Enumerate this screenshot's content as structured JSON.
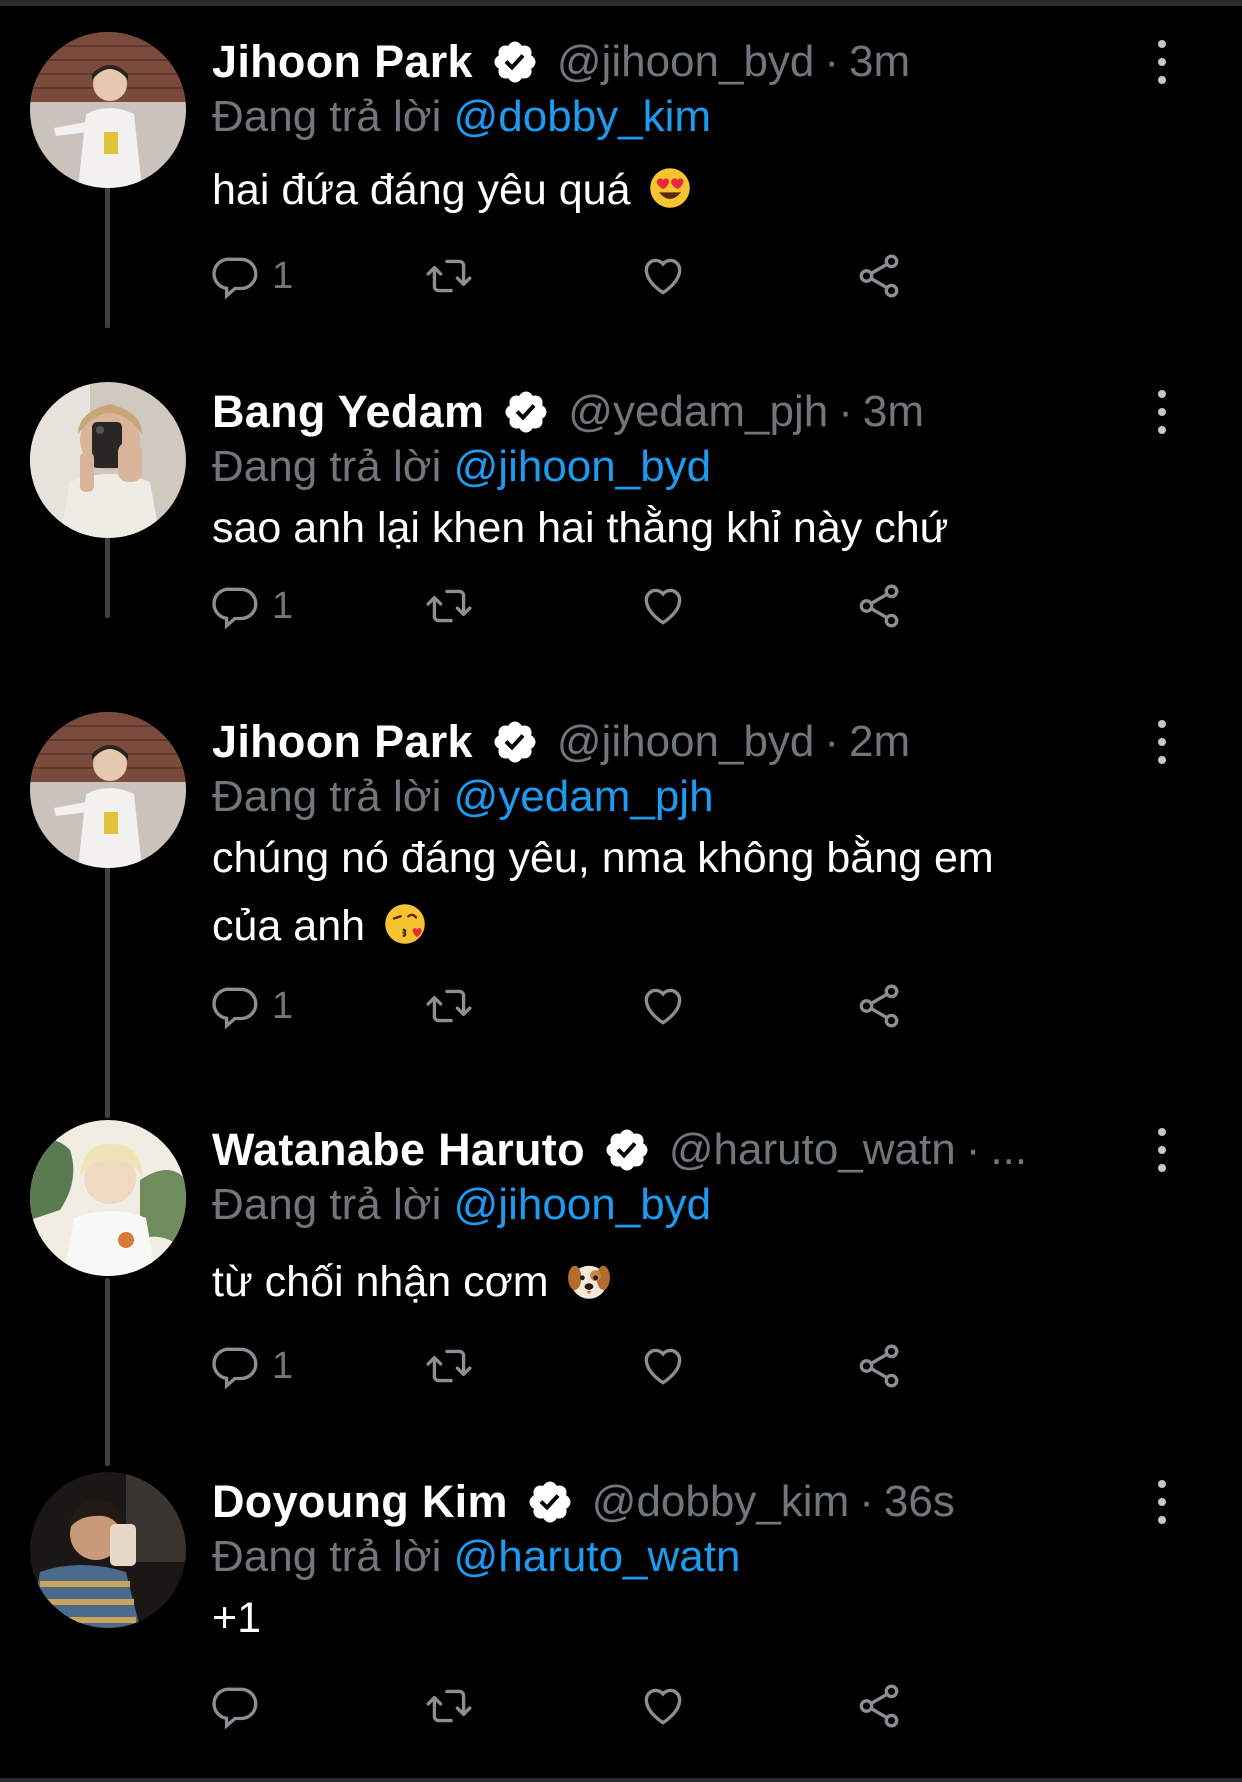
{
  "colors": {
    "background": "#000000",
    "mention": "#1d9bf0",
    "secondary_text": "#71767b",
    "verified_badge": "#ffffff"
  },
  "tweets": [
    {
      "name": "Jihoon Park",
      "handle": "@jihoon_byd",
      "separator": "·",
      "time": "3m",
      "reply_prefix": "Đang trả lời",
      "reply_to": "@dobby_kim",
      "text": "hai đứa đáng yêu quá",
      "emoji": "smiling-face-heart-eyes",
      "reply_count": "1",
      "avatar": "jihoon-avatar"
    },
    {
      "name": "Bang Yedam",
      "handle": "@yedam_pjh",
      "separator": "·",
      "time": "3m",
      "reply_prefix": "Đang trả lời",
      "reply_to": "@jihoon_byd",
      "text": "sao anh lại khen hai thằng khỉ này chứ",
      "emoji": "",
      "reply_count": "1",
      "avatar": "yedam-avatar"
    },
    {
      "name": "Jihoon Park",
      "handle": "@jihoon_byd",
      "separator": "·",
      "time": "2m",
      "reply_prefix": "Đang trả lời",
      "reply_to": "@yedam_pjh",
      "text_line1": "chúng nó đáng yêu, nma không bằng em",
      "text_line2": "của anh",
      "emoji": "face-blowing-kiss",
      "reply_count": "1",
      "avatar": "jihoon-avatar"
    },
    {
      "name": "Watanabe Haruto",
      "handle": "@haruto_watn",
      "separator": "·",
      "time": "...",
      "reply_prefix": "Đang trả lời",
      "reply_to": "@jihoon_byd",
      "text": "từ chối nhận cơm",
      "emoji": "dog-face",
      "reply_count": "1",
      "avatar": "haruto-avatar"
    },
    {
      "name": "Doyoung Kim",
      "handle": "@dobby_kim",
      "separator": "·",
      "time": "36s",
      "reply_prefix": "Đang trả lời",
      "reply_to": "@haruto_watn",
      "text": "+1",
      "emoji": "",
      "reply_count": "",
      "avatar": "doyoung-avatar"
    }
  ],
  "icons": {
    "reply": "reply-icon",
    "retweet": "retweet-icon",
    "like": "heart-icon",
    "share": "share-icon",
    "more": "more-vertical-icon",
    "verified": "verified-badge-icon"
  }
}
